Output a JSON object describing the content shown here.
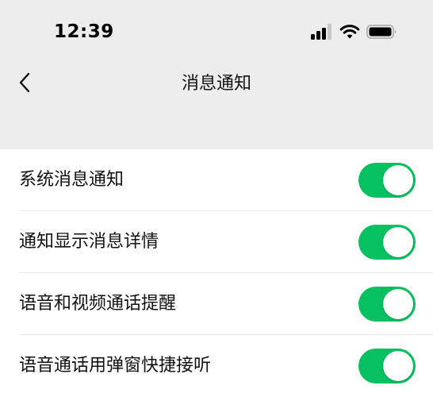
{
  "status_bar": {
    "time": "12:39",
    "icons": [
      "cellular-signal-icon",
      "wifi-icon",
      "battery-icon"
    ]
  },
  "nav": {
    "back_icon": "chevron-left-icon",
    "title": "消息通知"
  },
  "settings": [
    {
      "label": "系统消息通知",
      "enabled": true
    },
    {
      "label": "通知显示消息详情",
      "enabled": true
    },
    {
      "label": "语音和视频通话提醒",
      "enabled": true
    },
    {
      "label": "语音通话用弹窗快捷接听",
      "enabled": true
    }
  ],
  "colors": {
    "header_background": "#ededed",
    "toggle_on": "#07c160",
    "list_background": "#ffffff"
  }
}
